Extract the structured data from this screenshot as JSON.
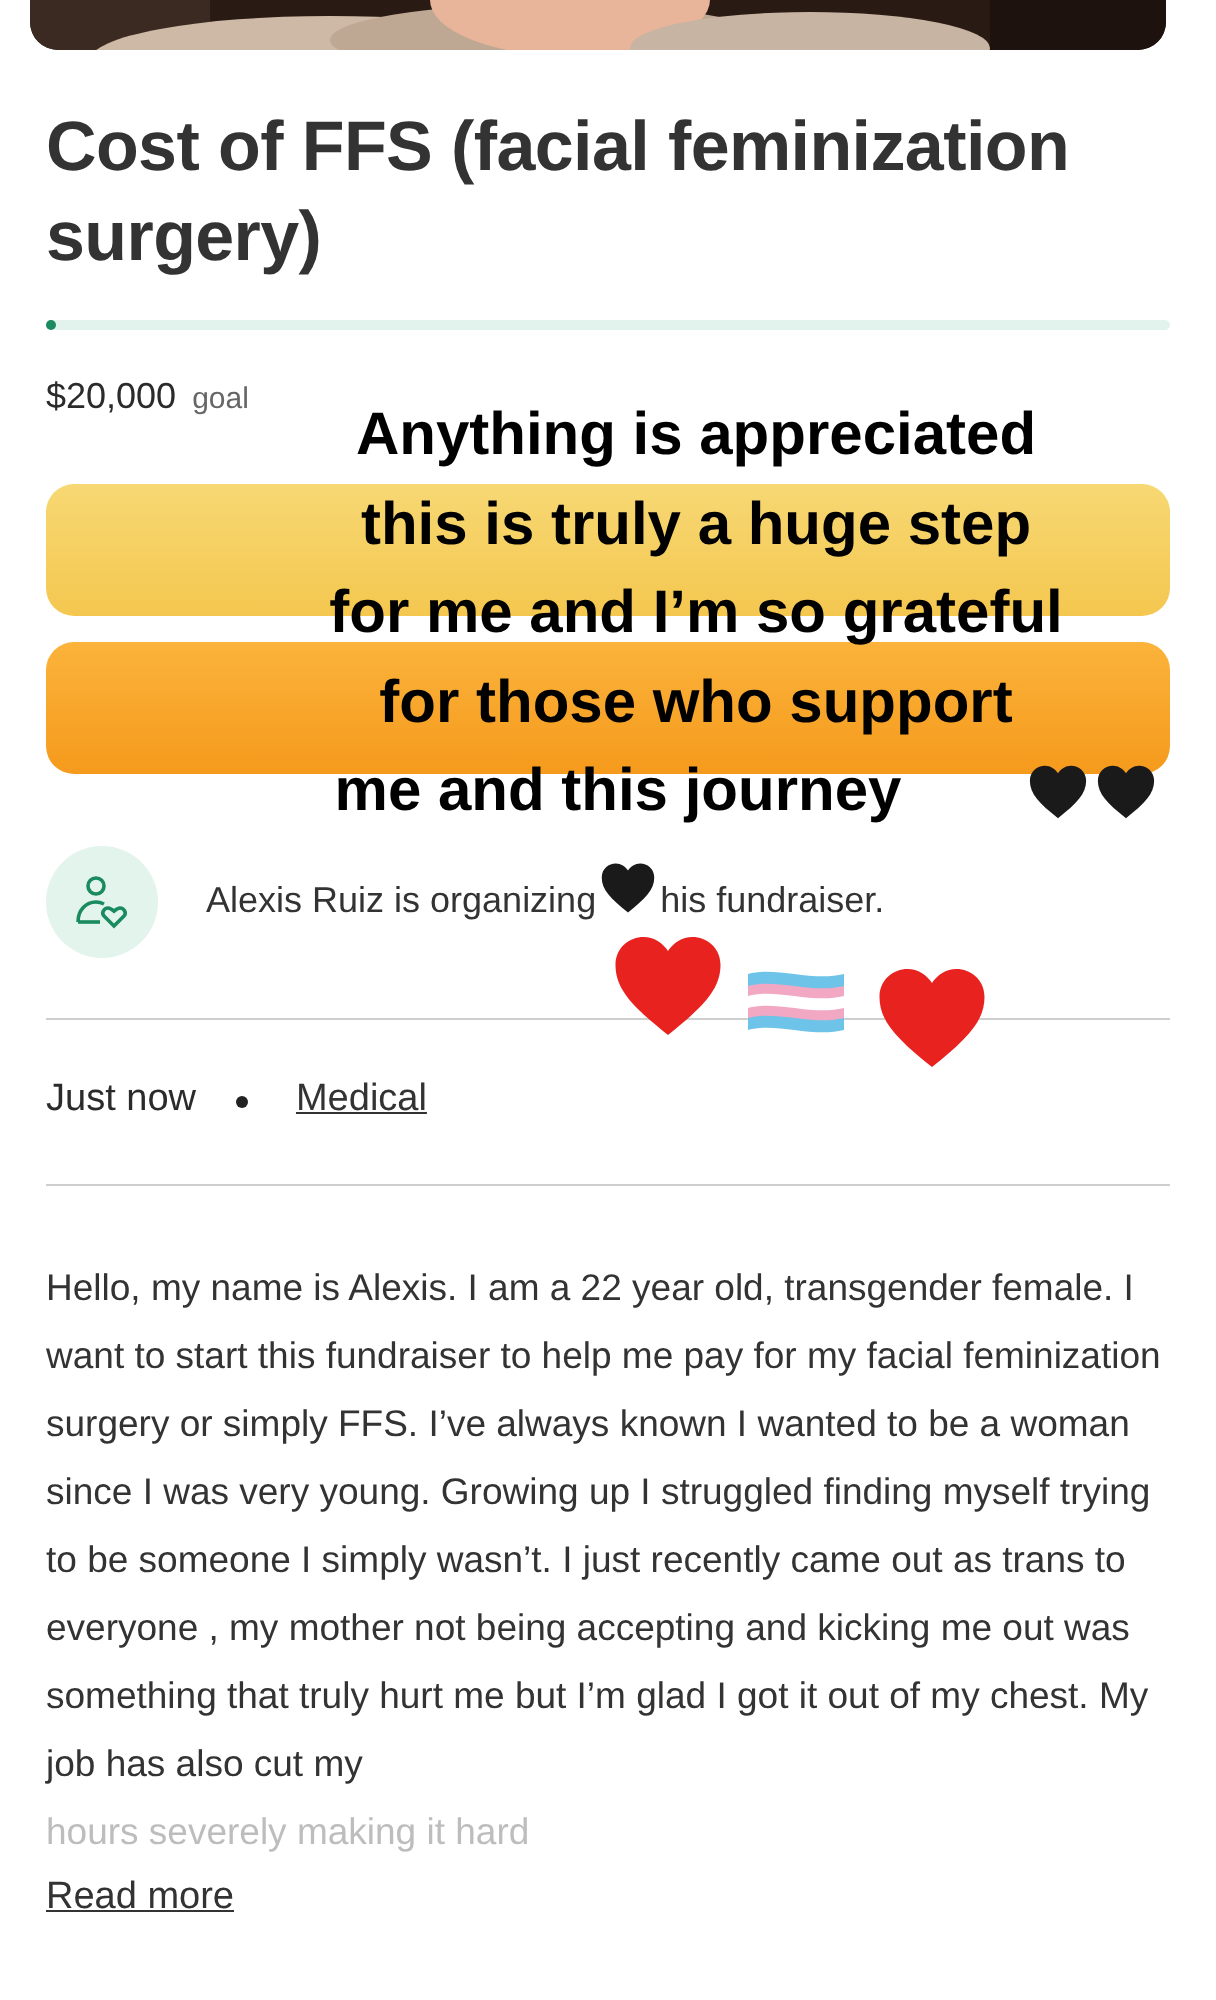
{
  "campaign": {
    "title": "Cost of FFS (facial feminization surgery)",
    "progress": {
      "level": 0.005
    },
    "goal_amount": "$20,000",
    "goal_label": "goal",
    "buttons": [
      {
        "kind": "share"
      },
      {
        "kind": "donate"
      }
    ],
    "organizer": [
      "Alexis Ruiz is organizing",
      "his fundraiser."
    ],
    "created": "Just now",
    "category": "Medical",
    "story": [
      "Hello, my name is Alexis. I am a 22 year old, transgender female. I want to start this fundraiser to help me pay for my facial feminization surgery or simply FFS. I’ve always known I wanted to be a woman since I was very young. Growing up I struggled finding myself trying to be someone I simply wasn’t. I just recently came out as trans to everyone , my mother not being accepting and kicking me out was something that truly hurt me but I’m glad I got it out of my chest. My job has also cut my"
    ],
    "story_faded": "hours severely making it hard",
    "read_more": "Read more"
  },
  "story_overlay": {
    "lines": [
      "Anything is appreciated",
      "this is truly a huge step",
      "for me and I’m so grateful",
      "for those who support",
      "me and this journey"
    ]
  }
}
